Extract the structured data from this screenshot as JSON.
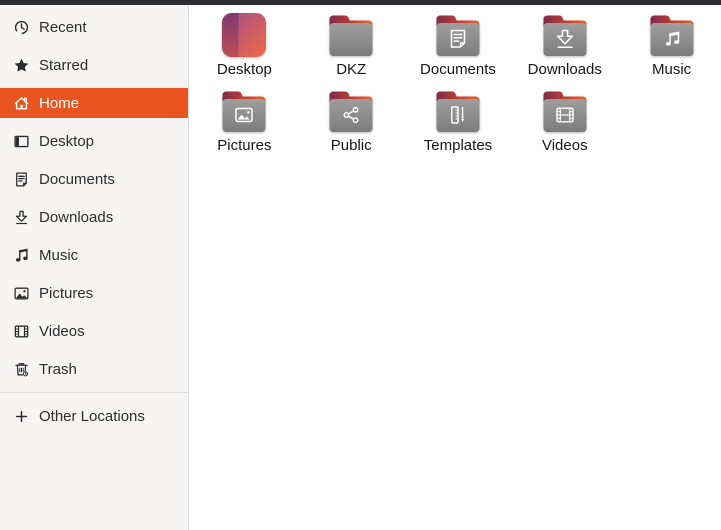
{
  "colors": {
    "accent": "#E95420",
    "selection_text": "#FFFFFF",
    "sidebar_bg": "#F6F5F4",
    "main_bg": "#FFFFFF",
    "top_strip": "#2E2D31",
    "folder_body_top": "#9D9D9D",
    "folder_body_bottom": "#7C7C7C",
    "folder_tab_left": "#7C2B4E",
    "folder_tab_mid": "#BB3F33",
    "folder_tab_right": "#EE6230",
    "desktop_icon_purple": "#A04B90",
    "desktop_icon_orange": "#EF6A43",
    "sidebar_text": "#2D2D2D",
    "label_text": "#161616"
  },
  "sidebar": {
    "items": [
      {
        "id": "recent",
        "label": "Recent",
        "icon": "recent-icon",
        "selected": false,
        "separator_before": false
      },
      {
        "id": "starred",
        "label": "Starred",
        "icon": "star-icon",
        "selected": false,
        "separator_before": false
      },
      {
        "id": "home",
        "label": "Home",
        "icon": "home-icon",
        "selected": true,
        "separator_before": false
      },
      {
        "id": "desktop",
        "label": "Desktop",
        "icon": "desktop-icon",
        "selected": false,
        "separator_before": false
      },
      {
        "id": "documents",
        "label": "Documents",
        "icon": "documents-icon",
        "selected": false,
        "separator_before": false
      },
      {
        "id": "downloads",
        "label": "Downloads",
        "icon": "downloads-icon",
        "selected": false,
        "separator_before": false
      },
      {
        "id": "music",
        "label": "Music",
        "icon": "music-icon",
        "selected": false,
        "separator_before": false
      },
      {
        "id": "pictures",
        "label": "Pictures",
        "icon": "pictures-icon",
        "selected": false,
        "separator_before": false
      },
      {
        "id": "videos",
        "label": "Videos",
        "icon": "videos-icon",
        "selected": false,
        "separator_before": false
      },
      {
        "id": "trash",
        "label": "Trash",
        "icon": "trash-icon",
        "selected": false,
        "separator_before": false
      },
      {
        "id": "other-locations",
        "label": "Other Locations",
        "icon": "plus-icon",
        "selected": false,
        "separator_before": true
      }
    ]
  },
  "files": {
    "items": [
      {
        "name": "Desktop",
        "icon": "desktop-special-icon",
        "emblem": null
      },
      {
        "name": "DKZ",
        "icon": "folder-icon",
        "emblem": null
      },
      {
        "name": "Documents",
        "icon": "folder-icon",
        "emblem": "document-emblem"
      },
      {
        "name": "Downloads",
        "icon": "folder-icon",
        "emblem": "download-emblem"
      },
      {
        "name": "Music",
        "icon": "folder-icon",
        "emblem": "music-emblem"
      },
      {
        "name": "Pictures",
        "icon": "folder-icon",
        "emblem": "picture-emblem"
      },
      {
        "name": "Public",
        "icon": "folder-icon",
        "emblem": "share-emblem"
      },
      {
        "name": "Templates",
        "icon": "folder-icon",
        "emblem": "template-emblem"
      },
      {
        "name": "Videos",
        "icon": "folder-icon",
        "emblem": "video-emblem"
      }
    ]
  }
}
